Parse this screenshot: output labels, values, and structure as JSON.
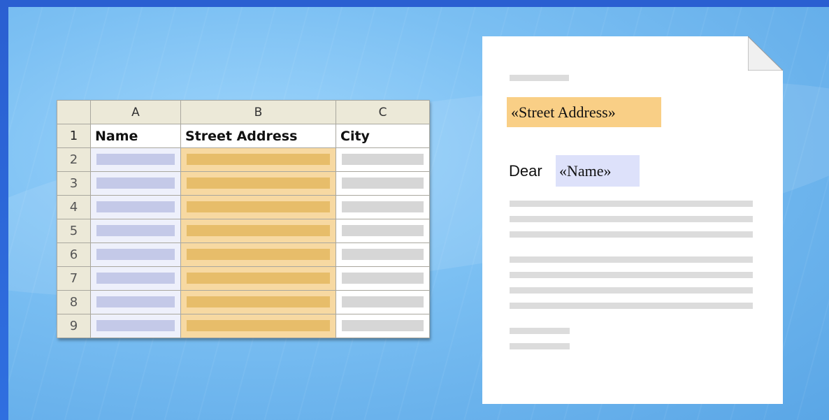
{
  "spreadsheet": {
    "column_headers": [
      "A",
      "B",
      "C"
    ],
    "row_numbers": [
      "1",
      "2",
      "3",
      "4",
      "5",
      "6",
      "7",
      "8",
      "9"
    ],
    "field_headers": [
      "Name",
      "Street Address",
      "City"
    ]
  },
  "letter": {
    "street_field": "«Street Address»",
    "salutation": "Dear",
    "name_field": "«Name»"
  },
  "colors": {
    "name_highlight": "#dde1fa",
    "street_highlight": "#f9cf86",
    "background": "#7cc0f3"
  }
}
